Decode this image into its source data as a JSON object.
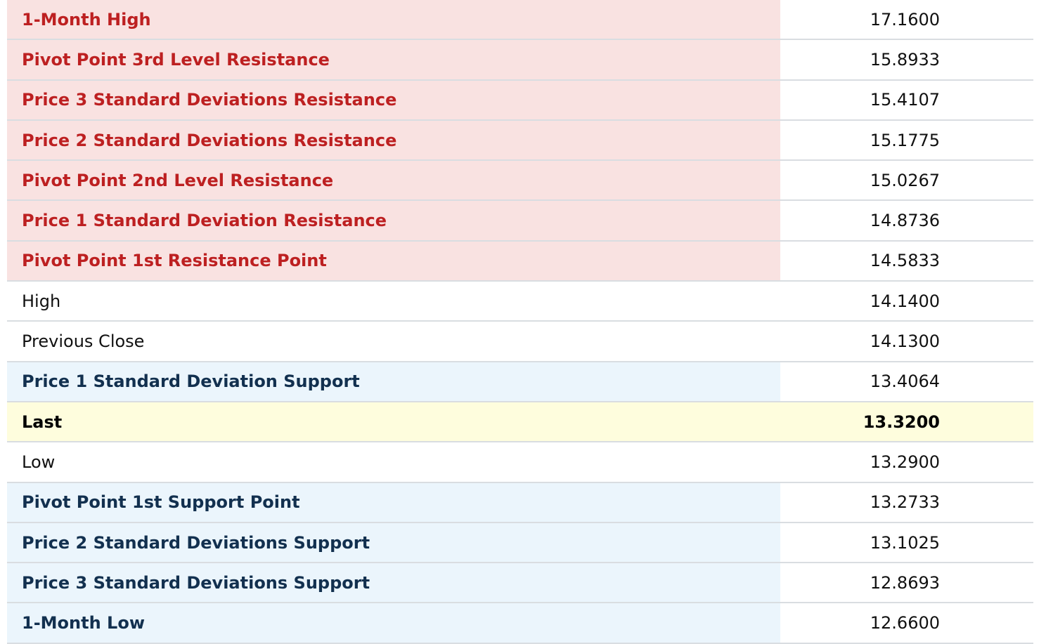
{
  "rows": [
    {
      "label": "1-Month High",
      "value": "17.1600",
      "kind": "resistance"
    },
    {
      "label": "Pivot Point 3rd Level Resistance",
      "value": "15.8933",
      "kind": "resistance"
    },
    {
      "label": "Price 3 Standard Deviations Resistance",
      "value": "15.4107",
      "kind": "resistance"
    },
    {
      "label": "Price 2 Standard Deviations Resistance",
      "value": "15.1775",
      "kind": "resistance"
    },
    {
      "label": "Pivot Point 2nd Level Resistance",
      "value": "15.0267",
      "kind": "resistance"
    },
    {
      "label": "Price 1 Standard Deviation Resistance",
      "value": "14.8736",
      "kind": "resistance"
    },
    {
      "label": "Pivot Point 1st Resistance Point",
      "value": "14.5833",
      "kind": "resistance"
    },
    {
      "label": "High",
      "value": "14.1400",
      "kind": "neutral"
    },
    {
      "label": "Previous Close",
      "value": "14.1300",
      "kind": "neutral"
    },
    {
      "label": "Price 1 Standard Deviation Support",
      "value": "13.4064",
      "kind": "support"
    },
    {
      "label": "Last",
      "value": "13.3200",
      "kind": "last"
    },
    {
      "label": "Low",
      "value": "13.2900",
      "kind": "neutral"
    },
    {
      "label": "Pivot Point 1st Support Point",
      "value": "13.2733",
      "kind": "support"
    },
    {
      "label": "Price 2 Standard Deviations Support",
      "value": "13.1025",
      "kind": "support"
    },
    {
      "label": "Price 3 Standard Deviations Support",
      "value": "12.8693",
      "kind": "support"
    },
    {
      "label": "1-Month Low",
      "value": "12.6600",
      "kind": "support"
    }
  ],
  "colors": {
    "resistance_bg": "#f9e2e1",
    "resistance_text": "#bd2021",
    "support_bg": "#ebf5fc",
    "support_text": "#12304f",
    "last_bg": "#fefddd",
    "divider": "#d9dde1"
  }
}
